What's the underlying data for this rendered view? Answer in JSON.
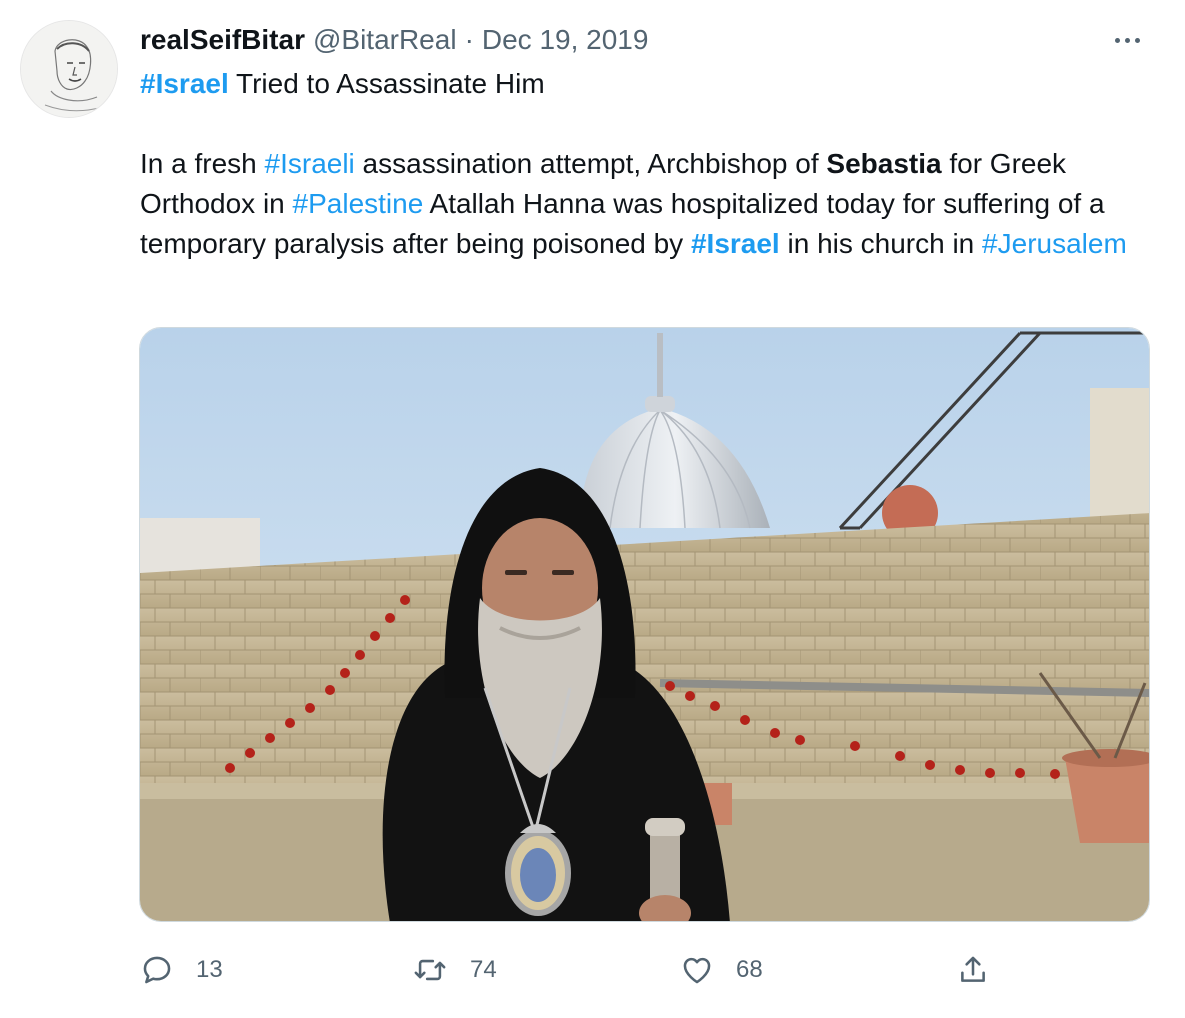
{
  "tweet": {
    "display_name": "realSeifBitar",
    "handle": "@BitarReal",
    "separator": "·",
    "date": "Dec 19, 2019",
    "line1": {
      "hashtag": "#Israel",
      "text": " Tried to Assassinate Him"
    },
    "body": {
      "t1": "In a fresh ",
      "h1": "#Israeli",
      "t2": " assassination attempt, Archbishop of ",
      "b1": "Sebastia",
      "t3": " for Greek Orthodox in ",
      "h2": "#Palestine",
      "t4": " Atallah Hanna was hospitalized today for suffering of a temporary paralysis after being poisoned by ",
      "h3": "#Israel",
      "t5": " in his church in ",
      "h4": "#Jerusalem"
    }
  },
  "actions": {
    "reply_count": "13",
    "retweet_count": "74",
    "like_count": "68"
  },
  "icons": {
    "more": "more-icon",
    "reply": "reply-icon",
    "retweet": "retweet-icon",
    "like": "like-icon",
    "share": "share-icon"
  },
  "colors": {
    "hashtag": "#1d9bf0",
    "secondary_text": "#536471",
    "primary_text": "#0f1419"
  }
}
